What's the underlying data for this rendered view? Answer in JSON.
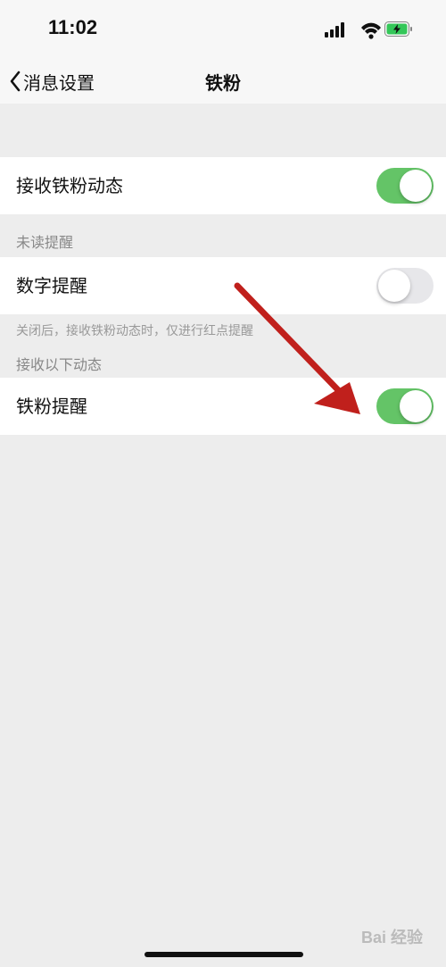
{
  "status": {
    "time": "11:02"
  },
  "nav": {
    "back_label": "消息设置",
    "title": "铁粉"
  },
  "rows": {
    "receive": {
      "label": "接收铁粉动态",
      "toggle": true
    },
    "digit": {
      "label": "数字提醒",
      "toggle": false
    },
    "fans": {
      "label": "铁粉提醒",
      "toggle": true
    }
  },
  "sections": {
    "unread": "未读提醒",
    "hint": "关闭后，接收铁粉动态时，仅进行红点提醒",
    "receive_below": "接收以下动态"
  },
  "watermark": "Bai 经验",
  "colors": {
    "toggle_on": "#64c467",
    "toggle_off": "#e7e7ea",
    "annotation_arrow": "#c0201c"
  }
}
